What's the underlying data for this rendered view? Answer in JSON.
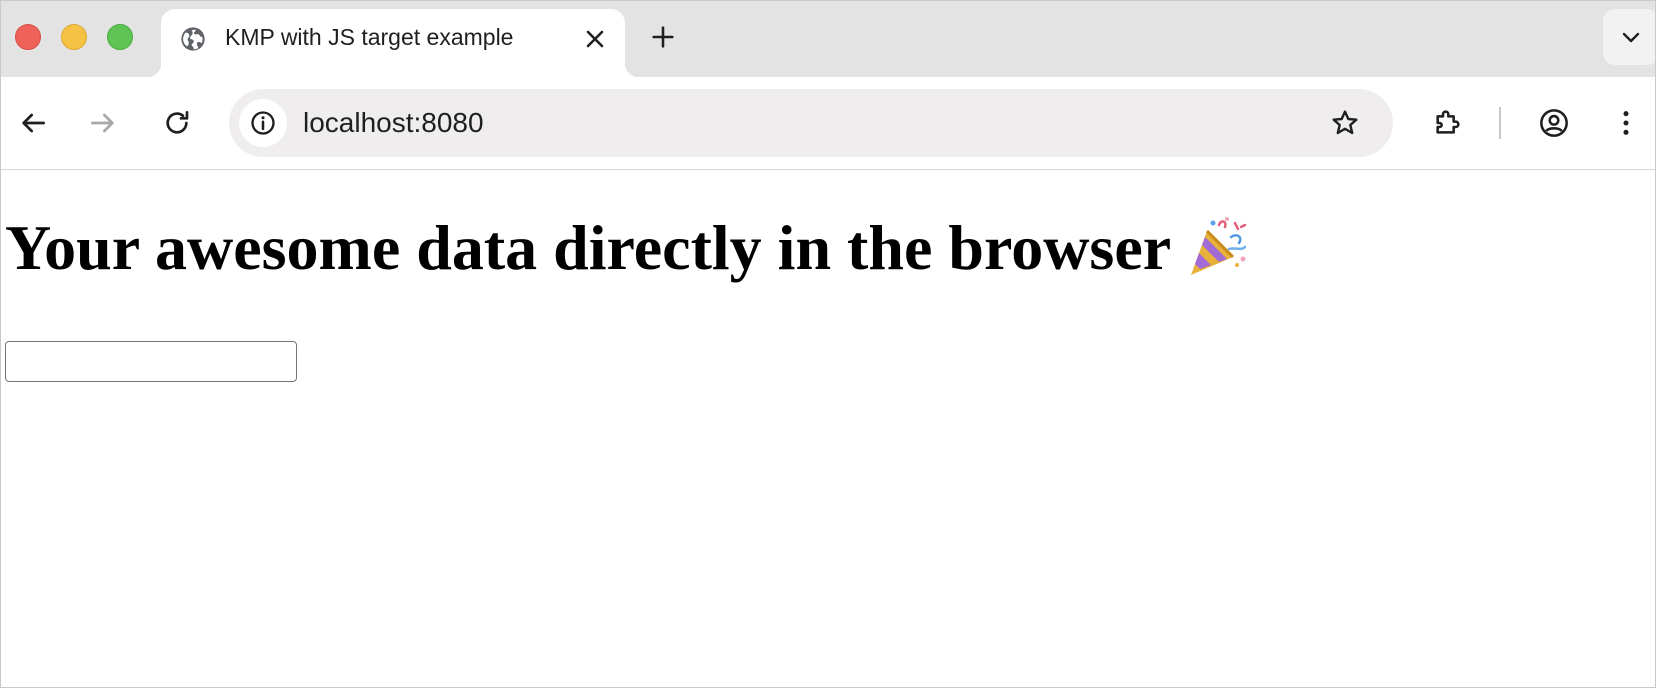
{
  "window": {
    "controls": [
      "close",
      "minimize",
      "zoom"
    ]
  },
  "tab": {
    "title": "KMP with JS target example",
    "favicon": "globe-icon"
  },
  "toolbar": {
    "back_icon": "arrow-left-icon",
    "forward_icon": "arrow-right-icon",
    "reload_icon": "reload-icon",
    "extensions_icon": "puzzle-icon",
    "profile_icon": "account-circle-icon",
    "menu_icon": "kebab-menu-icon"
  },
  "omnibox": {
    "url": "localhost:8080",
    "site_info_icon": "info-icon",
    "bookmark_icon": "star-icon"
  },
  "page": {
    "heading": "Your awesome data directly in the browser",
    "heading_icon": "party-popper-icon",
    "input_value": ""
  },
  "colors": {
    "close": "#ef625a",
    "minimize": "#f6c243",
    "zoom": "#5fc454",
    "tabstrip": "#e3e3e3",
    "omnibox": "#efeded"
  }
}
